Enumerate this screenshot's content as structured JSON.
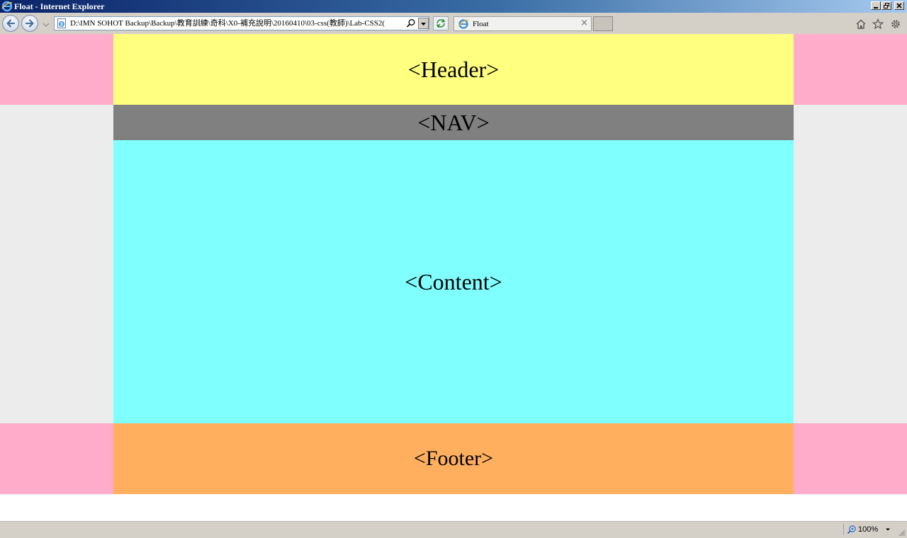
{
  "window": {
    "title": "Float - Internet Explorer"
  },
  "toolbar": {
    "address": "D:\\IMN SOHOT Backup\\Backup\\教育訓練\\奇科\\X0-補充說明\\20160410\\03-css(教師)\\Lab-CSS2(",
    "tab_title": "Float",
    "tab_close": "×"
  },
  "page": {
    "header": "<Header>",
    "nav": "<NAV>",
    "content": "<Content>",
    "footer": "<Footer>"
  },
  "statusbar": {
    "zoom": "100%"
  },
  "colors": {
    "header_bg": "#ffff80",
    "nav_bg": "#808080",
    "content_bg": "#80ffff",
    "footer_bg": "#ffaf5e",
    "side_pink": "#ffaccb",
    "side_gray": "#ececec"
  }
}
